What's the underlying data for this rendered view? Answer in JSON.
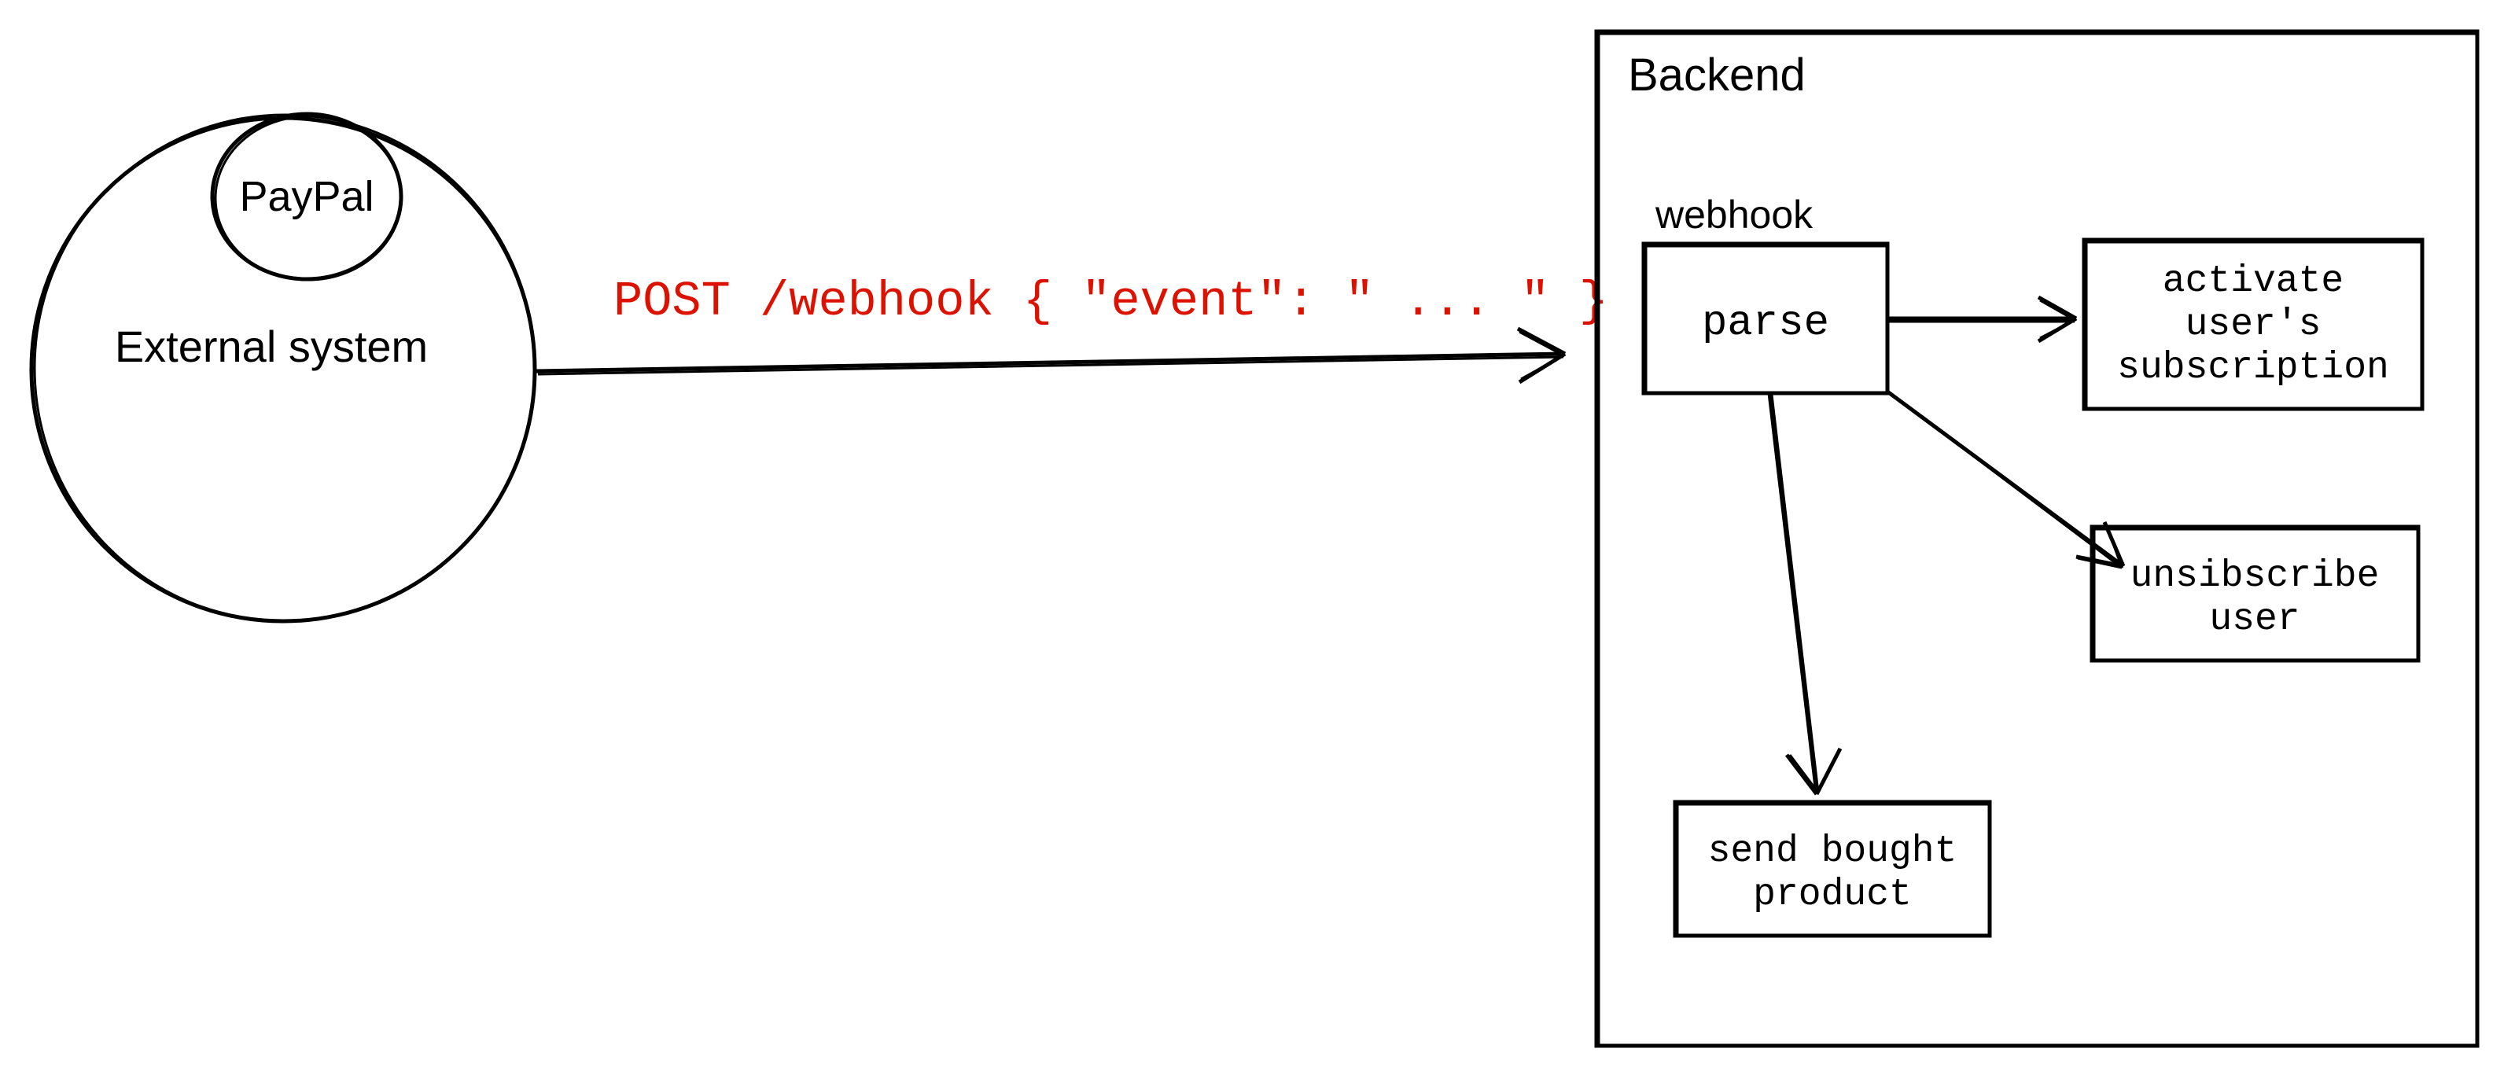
{
  "external": {
    "title": "External system",
    "provider": "PayPal"
  },
  "request": {
    "label": "POST /webhook { \"event\": \" ... \" }"
  },
  "backend": {
    "title": "Backend",
    "webhook_label": "webhook",
    "nodes": {
      "parse": "parse",
      "activate_line1": "activate",
      "activate_line2": "user's",
      "activate_line3": "subscription",
      "unsubscribe_line1": "unsibscribe",
      "unsubscribe_line2": "user",
      "send_line1": "send bought",
      "send_line2": "product"
    }
  }
}
